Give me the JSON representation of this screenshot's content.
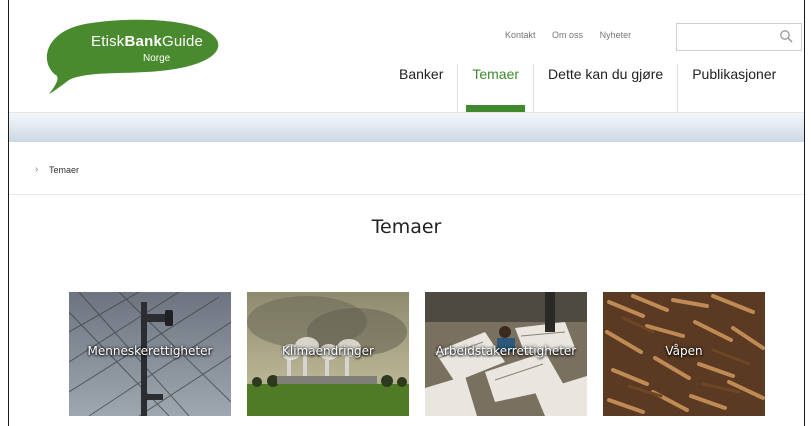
{
  "logo": {
    "text_light": "Etisk",
    "text_bold": "Bank",
    "text_end": "Guide",
    "subtitle": "Norge"
  },
  "utility_links": [
    "Kontakt",
    "Om oss",
    "Nyheter"
  ],
  "search": {
    "placeholder": "",
    "icon": "search-icon"
  },
  "nav": [
    "Banker",
    "Temaer",
    "Dette kan du gjøre",
    "Publikasjoner"
  ],
  "nav_active": "Temaer",
  "breadcrumb": {
    "current": "Temaer"
  },
  "page_title": "Temaer",
  "tiles": [
    "Menneskerettigheter",
    "Klimaendringer",
    "Arbeidstakerrettigheter",
    "Våpen"
  ],
  "colors": {
    "brand_green": "#3f8a2f",
    "band_blue": "#d3dfea"
  }
}
